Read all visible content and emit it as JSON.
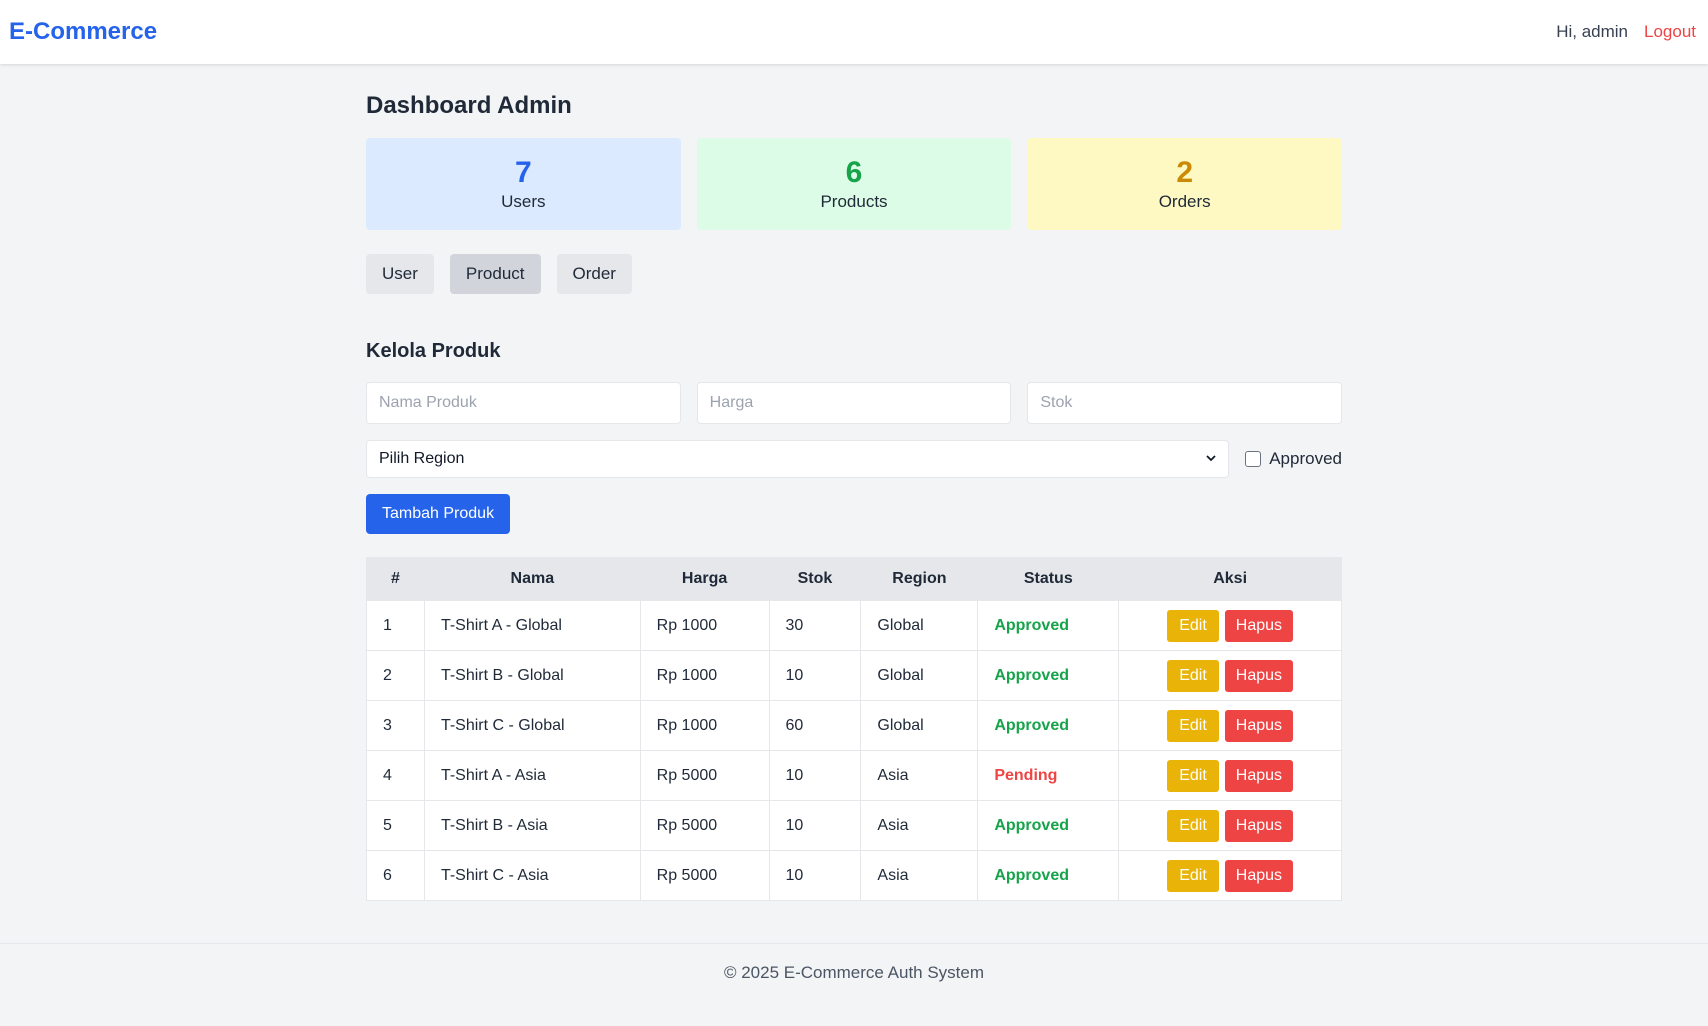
{
  "app": {
    "brand": "E-Commerce"
  },
  "nav": {
    "greeting": "Hi, admin",
    "logout": "Logout"
  },
  "page": {
    "title": "Dashboard Admin"
  },
  "stats": [
    {
      "value": "7",
      "label": "Users",
      "color": "#2563eb",
      "bg": "#dbeafe"
    },
    {
      "value": "6",
      "label": "Products",
      "color": "#16a34a",
      "bg": "#dcfce7"
    },
    {
      "value": "2",
      "label": "Orders",
      "color": "#ca8a04",
      "bg": "#fef9c3"
    }
  ],
  "tabs": [
    {
      "label": "User",
      "active": false
    },
    {
      "label": "Product",
      "active": true
    },
    {
      "label": "Order",
      "active": false
    }
  ],
  "form": {
    "title": "Kelola Produk",
    "name_placeholder": "Nama Produk",
    "price_placeholder": "Harga",
    "stock_placeholder": "Stok",
    "region_selected": "Pilih Region",
    "approved_label": "Approved",
    "submit_label": "Tambah Produk"
  },
  "table": {
    "headers": [
      "#",
      "Nama",
      "Harga",
      "Stok",
      "Region",
      "Status",
      "Aksi"
    ],
    "edit_label": "Edit",
    "delete_label": "Hapus",
    "status_colors": {
      "Approved": "#16a34a",
      "Pending": "#ef4444"
    },
    "rows": [
      {
        "id": "1",
        "name": "T-Shirt A - Global",
        "price": "Rp 1000",
        "stock": "30",
        "region": "Global",
        "status": "Approved"
      },
      {
        "id": "2",
        "name": "T-Shirt B - Global",
        "price": "Rp 1000",
        "stock": "10",
        "region": "Global",
        "status": "Approved"
      },
      {
        "id": "3",
        "name": "T-Shirt C - Global",
        "price": "Rp 1000",
        "stock": "60",
        "region": "Global",
        "status": "Approved"
      },
      {
        "id": "4",
        "name": "T-Shirt A - Asia",
        "price": "Rp 5000",
        "stock": "10",
        "region": "Asia",
        "status": "Pending"
      },
      {
        "id": "5",
        "name": "T-Shirt B - Asia",
        "price": "Rp 5000",
        "stock": "10",
        "region": "Asia",
        "status": "Approved"
      },
      {
        "id": "6",
        "name": "T-Shirt C - Asia",
        "price": "Rp 5000",
        "stock": "10",
        "region": "Asia",
        "status": "Approved"
      }
    ]
  },
  "footer": {
    "text": "© 2025 E-Commerce Auth System"
  }
}
